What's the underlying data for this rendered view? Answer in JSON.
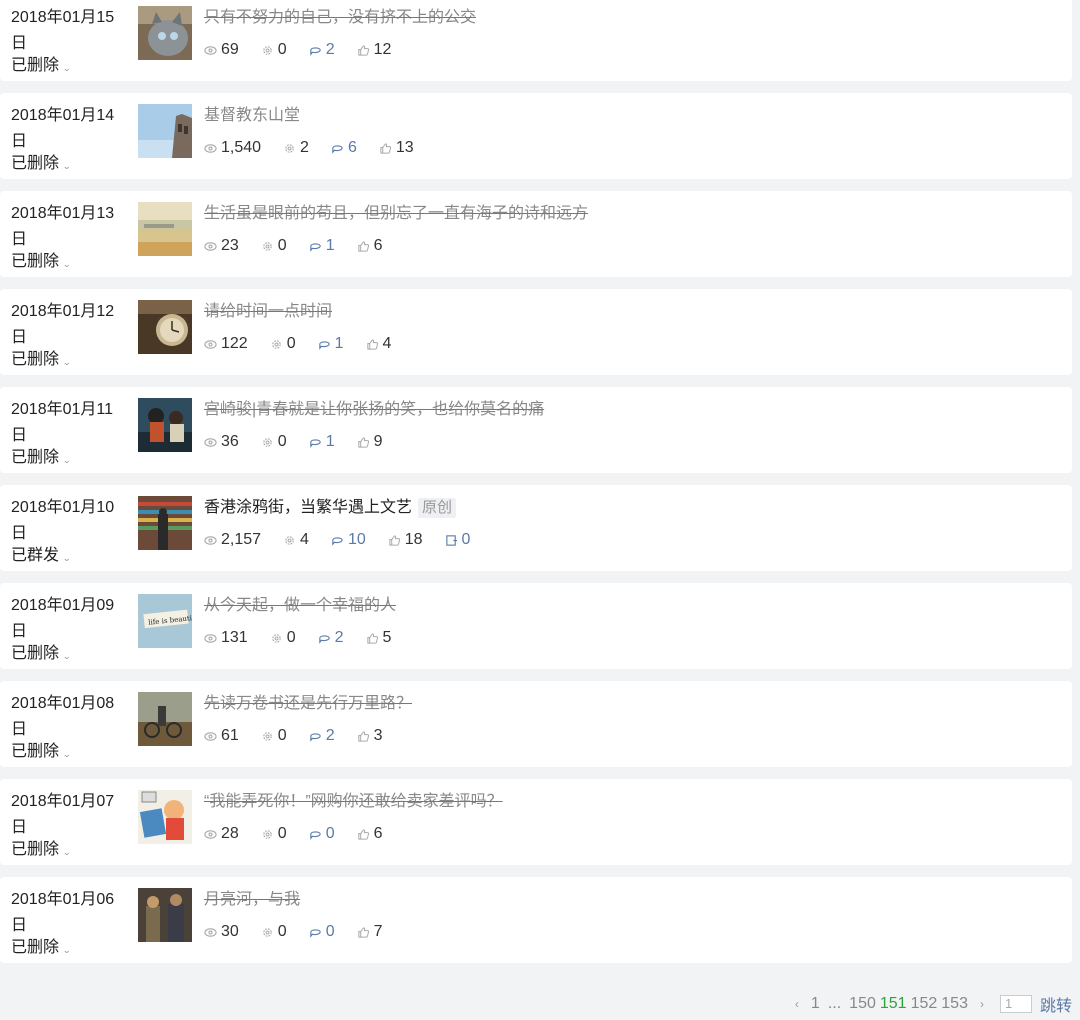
{
  "articles": [
    {
      "date": "2018年01月15日",
      "status": "已删除",
      "title": "只有不努力的自己，没有挤不上的公交",
      "deleted": true,
      "views": "69",
      "shares": "0",
      "comments": "2",
      "likes": "12",
      "thumb": "cat"
    },
    {
      "date": "2018年01月14日",
      "status": "已删除",
      "title": "基督教东山堂",
      "deleted": false,
      "views": "1,540",
      "shares": "2",
      "comments": "6",
      "likes": "13",
      "thumb": "church"
    },
    {
      "date": "2018年01月13日",
      "status": "已删除",
      "title": "生活虽是眼前的苟且，但别忘了一直有海子的诗和远方",
      "deleted": true,
      "views": "23",
      "shares": "0",
      "comments": "1",
      "likes": "6",
      "thumb": "beach"
    },
    {
      "date": "2018年01月12日",
      "status": "已删除",
      "title": "请给时间一点时间",
      "deleted": true,
      "views": "122",
      "shares": "0",
      "comments": "1",
      "likes": "4",
      "thumb": "clock"
    },
    {
      "date": "2018年01月11日",
      "status": "已删除",
      "title": "宫崎骏|青春就是让你张扬的笑，也给你莫名的痛",
      "deleted": true,
      "views": "36",
      "shares": "0",
      "comments": "1",
      "likes": "9",
      "thumb": "anime"
    },
    {
      "date": "2018年01月10日",
      "status": "已群发",
      "title": "香港涂鸦街，当繁华遇上文艺",
      "tag": "原创",
      "deleted": false,
      "live": true,
      "views": "2,157",
      "shares": "4",
      "comments": "10",
      "likes": "18",
      "reposts": "0",
      "thumb": "street"
    },
    {
      "date": "2018年01月09日",
      "status": "已删除",
      "title": "从今天起，做一个幸福的人",
      "deleted": true,
      "views": "131",
      "shares": "0",
      "comments": "2",
      "likes": "5",
      "thumb": "text"
    },
    {
      "date": "2018年01月08日",
      "status": "已删除",
      "title": "先读万卷书还是先行万里路？",
      "deleted": true,
      "views": "61",
      "shares": "0",
      "comments": "2",
      "likes": "3",
      "thumb": "bike"
    },
    {
      "date": "2018年01月07日",
      "status": "已删除",
      "title": "“我能弄死你！”网购你还敢给卖家差评吗？",
      "deleted": true,
      "views": "28",
      "shares": "0",
      "comments": "0",
      "likes": "6",
      "thumb": "cartoon"
    },
    {
      "date": "2018年01月06日",
      "status": "已删除",
      "title": "月亮河，与我",
      "deleted": true,
      "views": "30",
      "shares": "0",
      "comments": "0",
      "likes": "7",
      "thumb": "film"
    }
  ],
  "pagination": {
    "prev": "‹",
    "first": "1",
    "ellipsis": "...",
    "pages": [
      "150",
      "151",
      "152",
      "153"
    ],
    "current": "151",
    "next": "›",
    "input_value": "1",
    "jump_label": "跳转"
  }
}
